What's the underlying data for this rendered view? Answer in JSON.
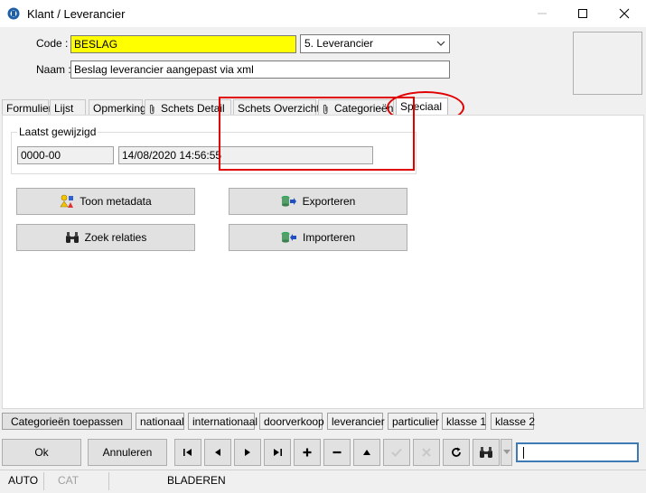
{
  "window": {
    "title": "Klant / Leverancier"
  },
  "form": {
    "code_label": "Code :",
    "code_value": "BESLAG",
    "type_value": "5. Leverancier",
    "naam_label": "Naam :",
    "naam_value": "Beslag leverancier aangepast via xml"
  },
  "tabs": [
    {
      "label": "Formulier"
    },
    {
      "label": "Lijst"
    },
    {
      "label": "Opmerking"
    },
    {
      "label": "Schets Detail"
    },
    {
      "label": "Schets Overzicht"
    },
    {
      "label": "Categorieën"
    },
    {
      "label": "Speciaal"
    }
  ],
  "panel": {
    "group_title": "Laatst gewijzigd",
    "user_value": "0000-00",
    "date_value": "14/08/2020 14:56:55",
    "btn_metadata": "Toon metadata",
    "btn_relaties": "Zoek relaties",
    "btn_export": "Exporteren",
    "btn_import": "Importeren"
  },
  "filters": {
    "apply": "Categorieën toepassen",
    "items": [
      "nationaal",
      "internationaal",
      "doorverkoop",
      "leverancier",
      "particulier",
      "klasse 1",
      "klasse 2"
    ]
  },
  "nav": {
    "ok": "Ok",
    "cancel": "Annuleren"
  },
  "status": {
    "auto": "AUTO",
    "cat": "CAT",
    "mode": "BLADEREN"
  },
  "colors": {
    "highlight": "#e00000",
    "code_bg": "#ffff00",
    "focus": "#3d7ab6"
  }
}
